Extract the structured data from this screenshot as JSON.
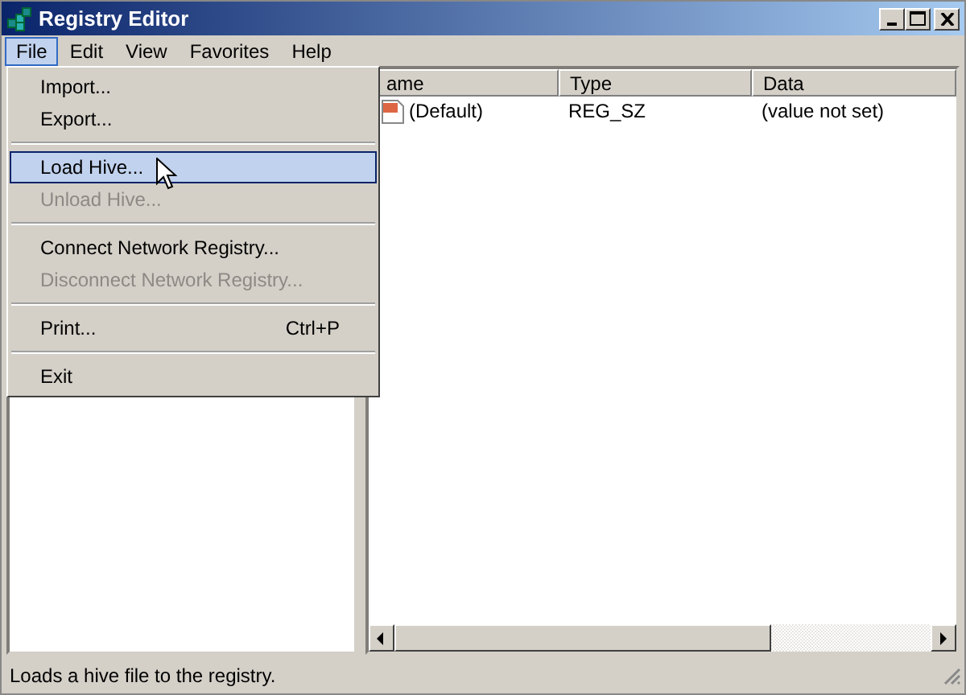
{
  "window": {
    "title": "Registry Editor"
  },
  "menu_bar": [
    {
      "label": "File",
      "selected": true
    },
    {
      "label": "Edit",
      "selected": false
    },
    {
      "label": "View",
      "selected": false
    },
    {
      "label": "Favorites",
      "selected": false
    },
    {
      "label": "Help",
      "selected": false
    }
  ],
  "file_menu": [
    {
      "kind": "item",
      "label": "Import...",
      "disabled": false,
      "selected": false
    },
    {
      "kind": "item",
      "label": "Export...",
      "disabled": false,
      "selected": false
    },
    {
      "kind": "separator"
    },
    {
      "kind": "item",
      "label": "Load Hive...",
      "disabled": false,
      "selected": true
    },
    {
      "kind": "item",
      "label": "Unload Hive...",
      "disabled": true,
      "selected": false
    },
    {
      "kind": "separator"
    },
    {
      "kind": "item",
      "label": "Connect Network Registry...",
      "disabled": false,
      "selected": false
    },
    {
      "kind": "item",
      "label": "Disconnect Network Registry...",
      "disabled": true,
      "selected": false
    },
    {
      "kind": "separator"
    },
    {
      "kind": "item",
      "label": "Print...",
      "shortcut": "Ctrl+P",
      "disabled": false,
      "selected": false
    },
    {
      "kind": "separator"
    },
    {
      "kind": "item",
      "label": "Exit",
      "disabled": false,
      "selected": false
    }
  ],
  "values_table": {
    "columns": [
      "ame",
      "Type",
      "Data"
    ],
    "rows": [
      {
        "name": "(Default)",
        "type": "REG_SZ",
        "data": "(value not set)"
      }
    ]
  },
  "status_bar": "Loads a hive file to the registry."
}
